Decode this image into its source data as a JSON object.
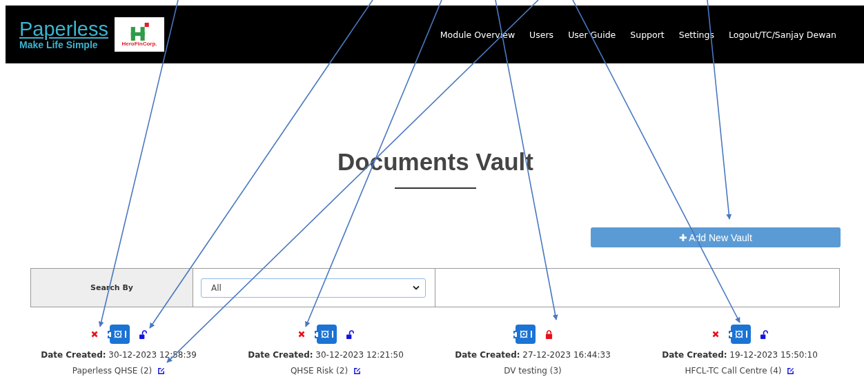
{
  "header": {
    "brand": {
      "name": "Paperless",
      "tagline": "Make Life Simple"
    },
    "partner_logo": {
      "text": "HeroFinCorp."
    },
    "nav": [
      "Module Overview",
      "Users",
      "User Guide",
      "Support",
      "Settings",
      "Logout/TC/Sanjay Dewan"
    ]
  },
  "page_title": "Documents Vault",
  "add_button": {
    "icon": "✚",
    "label": "Add New Vault"
  },
  "search": {
    "label": "Search By",
    "select_value": "All"
  },
  "vaults": [
    {
      "deletable": true,
      "locked": false,
      "date_label": "Date Created:",
      "date": "30-12-2023 12:58:39",
      "name": "Paperless QHSE (2)",
      "editable": true
    },
    {
      "deletable": true,
      "locked": false,
      "date_label": "Date Created:",
      "date": "30-12-2023 12:21:50",
      "name": "QHSE Risk (2)",
      "editable": true
    },
    {
      "deletable": false,
      "locked": true,
      "date_label": "Date Created:",
      "date": "27-12-2023 16:44:33",
      "name": "DV testing (3)",
      "editable": false
    },
    {
      "deletable": true,
      "locked": false,
      "date_label": "Date Created:",
      "date": "19-12-2023 15:50:10",
      "name": "HFCL-TC Call Centre (4)",
      "editable": true
    }
  ]
}
